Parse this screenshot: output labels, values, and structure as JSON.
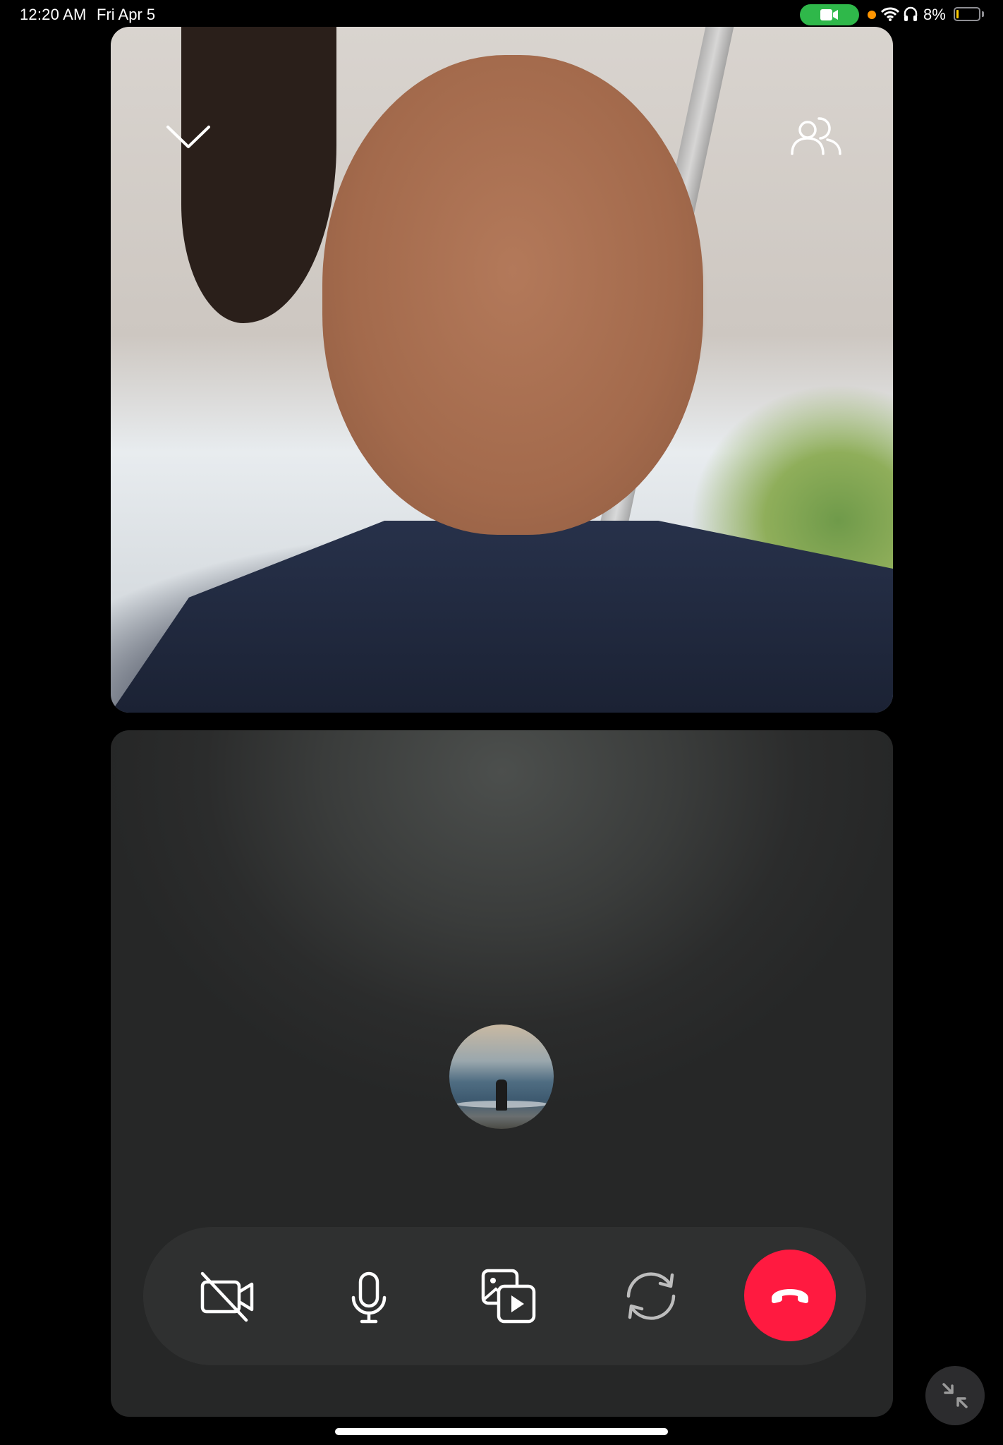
{
  "status_bar": {
    "time": "12:20 AM",
    "date": "Fri Apr 5",
    "battery_percent": "8%",
    "battery_level": 0.08,
    "icons": [
      "video-camera-icon",
      "wifi-icon",
      "headphones-icon",
      "battery-icon"
    ],
    "camera_indicator_color": "#2fb84a",
    "mic_indicator_color": "#ff9500"
  },
  "remote_video": {
    "icons": [
      "chevron-down-icon",
      "participants-icon"
    ]
  },
  "local_tile": {
    "avatar_icon": "profile-avatar"
  },
  "controls": {
    "items": [
      "camera-off-icon",
      "microphone-icon",
      "media-share-icon",
      "switch-camera-icon",
      "end-call-icon"
    ],
    "end_call_color": "#ff1a40"
  },
  "minimize_icon": "minimize-arrows-icon"
}
